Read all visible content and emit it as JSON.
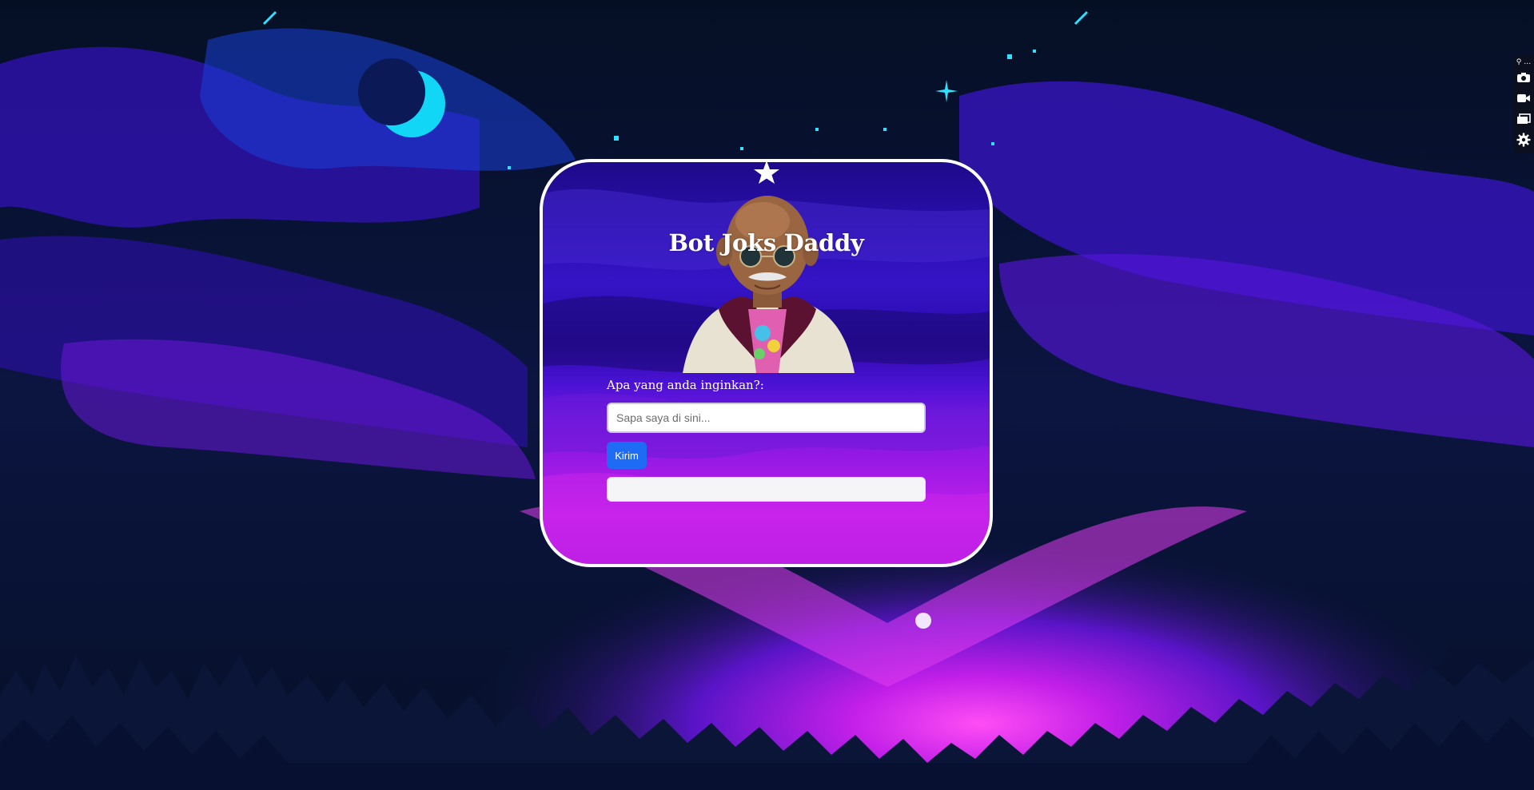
{
  "app": {
    "title": "Bot Joks Daddy"
  },
  "form": {
    "prompt_label": "Apa yang anda inginkan?:",
    "input_placeholder": "Sapa saya di sini...",
    "input_value": "",
    "send_label": "Kirim",
    "response_text": ""
  },
  "toolbar": {
    "top_text": "⚲ …",
    "items": [
      {
        "icon": "camera-icon"
      },
      {
        "icon": "video-camera-icon"
      },
      {
        "icon": "windows-icon"
      },
      {
        "icon": "gear-icon"
      }
    ]
  },
  "colors": {
    "sky_dark": "#06122a",
    "sky_purple": "#3a14c8",
    "glow_magenta": "#c21fe8",
    "moon_cyan": "#12d6f5",
    "button_blue": "#1e6cf5",
    "card_border": "#ffffff"
  }
}
